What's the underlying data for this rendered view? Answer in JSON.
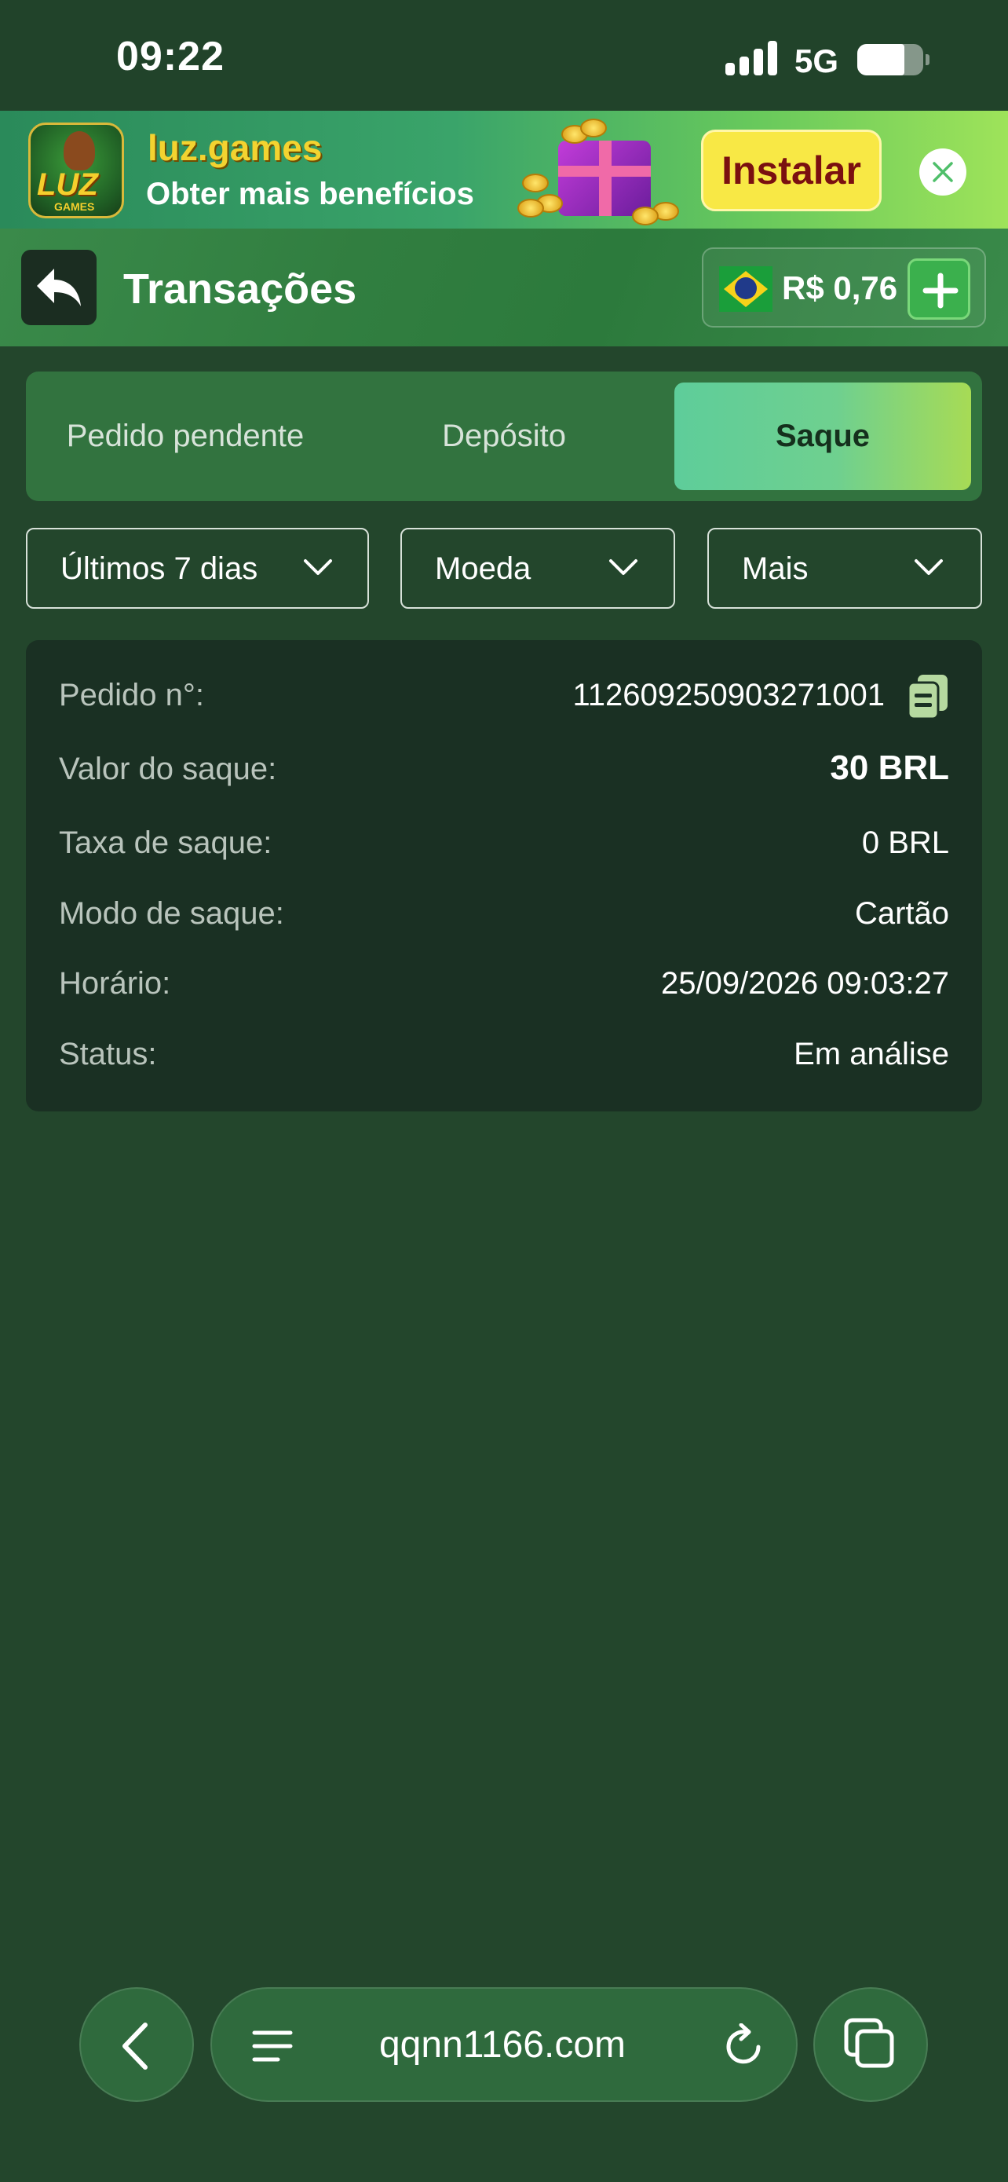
{
  "status_bar": {
    "time": "09:22",
    "network": "5G"
  },
  "banner": {
    "app_name": "luz.games",
    "subtitle": "Obter mais benefícios",
    "install_label": "Instalar",
    "icon_text": "LUZ",
    "icon_subtext": "GAMES"
  },
  "header": {
    "title": "Transações",
    "balance": "R$ 0,76"
  },
  "tabs": [
    {
      "label": "Pedido pendente",
      "active": false
    },
    {
      "label": "Depósito",
      "active": false
    },
    {
      "label": "Saque",
      "active": true
    }
  ],
  "filters": {
    "period": "Últimos 7 dias",
    "currency": "Moeda",
    "more": "Mais"
  },
  "transaction": {
    "order_label": "Pedido n°:",
    "order_value": "112609250903271001",
    "amount_label": "Valor do saque:",
    "amount_value": "30 BRL",
    "fee_label": "Taxa de saque:",
    "fee_value": "0 BRL",
    "mode_label": "Modo de saque:",
    "mode_value": "Cartão",
    "time_label": "Horário:",
    "time_value": "25/09/2026 09:03:27",
    "status_label": "Status:",
    "status_value": "Em análise"
  },
  "browser": {
    "url": "qqnn1166.com"
  },
  "colors": {
    "background": "#23462c",
    "accent_gradient_start": "#5ecd9a",
    "accent_gradient_end": "#a7db55",
    "install_button": "#f8e845",
    "card": "#1a3023"
  }
}
